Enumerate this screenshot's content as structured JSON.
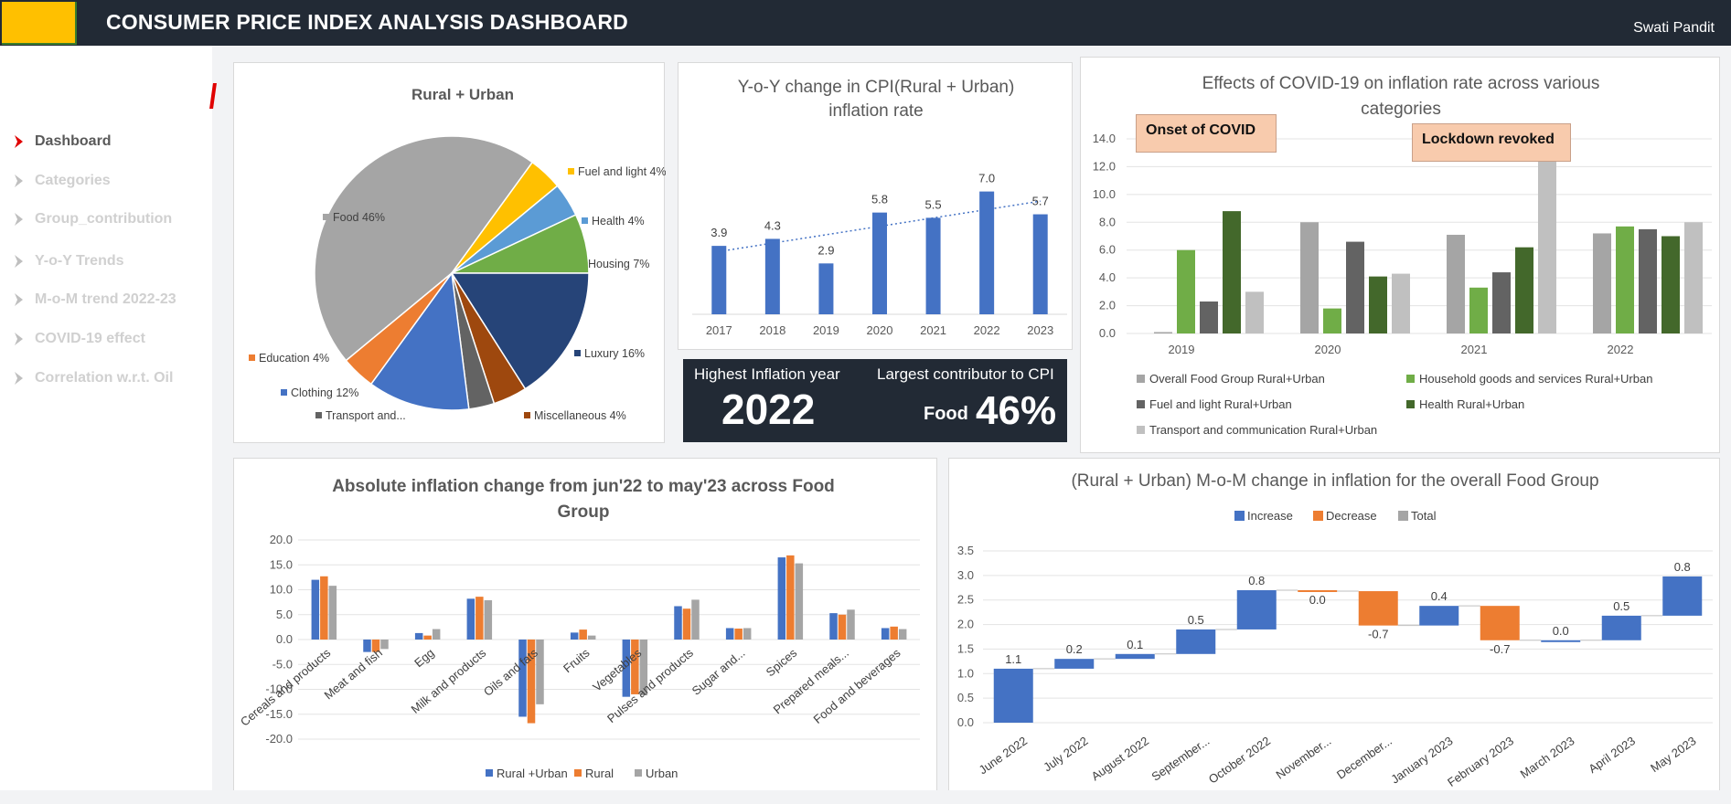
{
  "header": {
    "title": "CONSUMER PRICE INDEX ANALYSIS DASHBOARD",
    "user": "Swati Pandit"
  },
  "sidebar": {
    "items": [
      {
        "label": "Dashboard",
        "active": true
      },
      {
        "label": "Categories",
        "active": false
      },
      {
        "label": "Group_contribution",
        "active": false
      },
      {
        "label": "Y-o-Y Trends",
        "active": false
      },
      {
        "label": "M-o-M trend 2022-23",
        "active": false
      },
      {
        "label": "COVID-19 effect",
        "active": false
      },
      {
        "label": "Correlation w.r.t. Oil",
        "active": false
      }
    ]
  },
  "kpi": {
    "highest_label": "Highest Inflation year",
    "highest_value": "2022",
    "contributor_label": "Largest contributor to CPI",
    "contributor_name": "Food",
    "contributor_value": "46%"
  },
  "covid_callouts": {
    "onset": "Onset of COVID",
    "lockdown": "Lockdown revoked"
  },
  "colors": {
    "blue": "#4472c4",
    "orange": "#ed7d31",
    "gray": "#a5a5a5",
    "dark": "#222a35",
    "accent": "#ffc000"
  },
  "chart_data": [
    {
      "id": "pie",
      "type": "pie",
      "title": "Rural + Urban",
      "slices": [
        {
          "label": "Food 46%",
          "value": 46,
          "color": "#a5a5a5"
        },
        {
          "label": "Fuel and light 4%",
          "value": 4,
          "color": "#ffc000"
        },
        {
          "label": "Health 4%",
          "value": 4,
          "color": "#5b9bd5"
        },
        {
          "label": "Housing 7%",
          "value": 7,
          "color": "#70ad47"
        },
        {
          "label": "Luxury 16%",
          "value": 16,
          "color": "#264478"
        },
        {
          "label": "Miscellaneous 4%",
          "value": 4,
          "color": "#9e480e"
        },
        {
          "label": "Transport and...",
          "value": 3,
          "color": "#636363"
        },
        {
          "label": "Clothing 12%",
          "value": 12,
          "color": "#4472c4"
        },
        {
          "label": "Education 4%",
          "value": 4,
          "color": "#ed7d31"
        }
      ]
    },
    {
      "id": "yoy",
      "type": "bar",
      "title": "Y-o-Y change in CPI(Rural + Urban) inflation rate",
      "categories": [
        "2017",
        "2018",
        "2019",
        "2020",
        "2021",
        "2022",
        "2023"
      ],
      "values": [
        3.9,
        4.3,
        2.9,
        5.8,
        5.5,
        7.0,
        5.7
      ],
      "value_labels": [
        "3.9",
        "4.3",
        "2.9",
        "5.8",
        "5.5",
        "7.0",
        "5.7"
      ],
      "trendline": "linear"
    },
    {
      "id": "covid",
      "type": "bar",
      "title": "Effects of COVID-19 on inflation rate across various categories",
      "categories": [
        "2019",
        "2020",
        "2021",
        "2022"
      ],
      "ylim": [
        0,
        14
      ],
      "yticks": [
        "0.0",
        "2.0",
        "4.0",
        "6.0",
        "8.0",
        "10.0",
        "12.0",
        "14.0"
      ],
      "series": [
        {
          "name": "Overall Food Group Rural+Urban",
          "color": "#a5a5a5",
          "values": [
            0.1,
            8.0,
            7.1,
            7.2
          ]
        },
        {
          "name": "Household goods and services Rural+Urban",
          "color": "#70ad47",
          "values": [
            6.0,
            1.8,
            3.3,
            7.7
          ]
        },
        {
          "name": "Fuel and light Rural+Urban",
          "color": "#636363",
          "values": [
            2.3,
            6.6,
            4.4,
            7.5
          ]
        },
        {
          "name": "Health Rural+Urban",
          "color": "#43682b",
          "values": [
            8.8,
            4.1,
            6.2,
            7.0
          ]
        },
        {
          "name": "Transport and communication Rural+Urban",
          "color": "#c0c0c0",
          "values": [
            3.0,
            4.3,
            12.5,
            8.0
          ]
        }
      ]
    },
    {
      "id": "food",
      "type": "bar",
      "title": "Absolute inflation change from jun'22 to may'23 across Food Group",
      "categories": [
        "Cereals and products",
        "Meat and fish",
        "Egg",
        "Milk and products",
        "Oils and fats",
        "Fruits",
        "Vegetables",
        "Pulses and products",
        "Sugar and...",
        "Spices",
        "Prepared meals...",
        "Food and beverages"
      ],
      "ylim": [
        -20,
        20
      ],
      "yticks": [
        "-20.0",
        "-15.0",
        "-10.0",
        "-5.0",
        "0.0",
        "5.0",
        "10.0",
        "15.0",
        "20.0"
      ],
      "series": [
        {
          "name": "Rural +Urban",
          "color": "#4472c4",
          "values": [
            12.0,
            -2.5,
            1.3,
            8.2,
            -15.5,
            1.4,
            -11.5,
            6.7,
            2.3,
            16.5,
            5.3,
            2.3
          ]
        },
        {
          "name": "Rural",
          "color": "#ed7d31",
          "values": [
            12.7,
            -2.5,
            0.8,
            8.6,
            -16.8,
            2.0,
            -11.0,
            6.2,
            2.2,
            16.9,
            5.0,
            2.6
          ]
        },
        {
          "name": "Urban",
          "color": "#a5a5a5",
          "values": [
            10.8,
            -1.9,
            2.1,
            7.9,
            -13.0,
            0.8,
            -11.2,
            8.0,
            2.3,
            15.3,
            6.0,
            2.1
          ]
        }
      ]
    },
    {
      "id": "mom",
      "type": "bar",
      "title": "(Rural + Urban) M-o-M change in inflation for the overall Food Group",
      "legend": [
        "Increase",
        "Decrease",
        "Total"
      ],
      "legend_colors": [
        "#4472c4",
        "#ed7d31",
        "#a5a5a5"
      ],
      "ylim": [
        0,
        3.5
      ],
      "yticks": [
        "0.0",
        "0.5",
        "1.0",
        "1.5",
        "2.0",
        "2.5",
        "3.0",
        "3.5"
      ],
      "categories": [
        "June 2022",
        "July 2022",
        "August 2022",
        "September...",
        "October 2022",
        "November...",
        "December...",
        "January 2023",
        "February 2023",
        "March 2023",
        "April 2023",
        "May 2023"
      ],
      "changes": [
        1.1,
        0.2,
        0.1,
        0.5,
        0.8,
        -0.02,
        -0.7,
        0.4,
        -0.7,
        0.0,
        0.5,
        0.8
      ],
      "value_labels": [
        "1.1",
        "0.2",
        "0.1",
        "0.5",
        "0.8",
        "0.0",
        "-0.7",
        "0.4",
        "-0.7",
        "0.0",
        "0.5",
        "0.8"
      ]
    }
  ]
}
